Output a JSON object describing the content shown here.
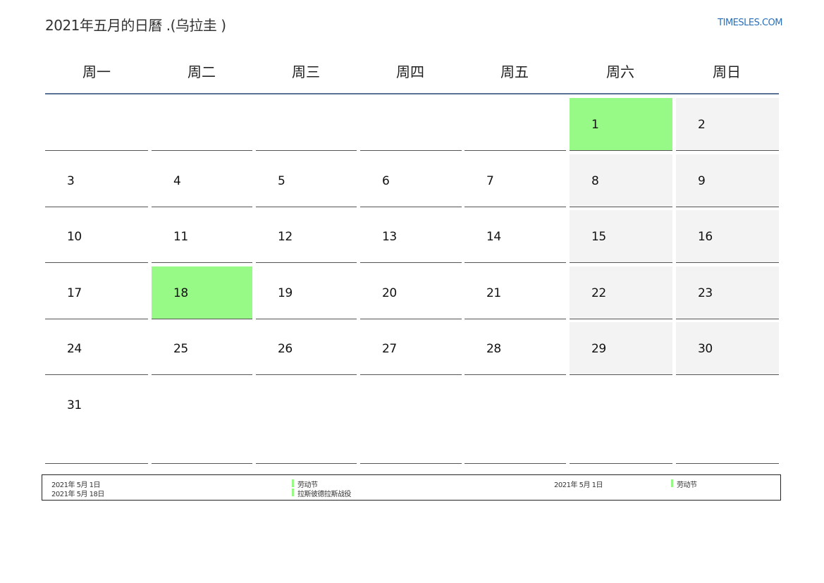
{
  "title": "2021年五月的日曆 .(乌拉圭 )",
  "brand": "TIMESLES.COM",
  "weekdays": [
    "周一",
    "周二",
    "周三",
    "周四",
    "周五",
    "周六",
    "周日"
  ],
  "days": {
    "d1": "1",
    "d2": "2",
    "d3": "3",
    "d4": "4",
    "d5": "5",
    "d6": "6",
    "d7": "7",
    "d8": "8",
    "d9": "9",
    "d10": "10",
    "d11": "11",
    "d12": "12",
    "d13": "13",
    "d14": "14",
    "d15": "15",
    "d16": "16",
    "d17": "17",
    "d18": "18",
    "d19": "19",
    "d20": "20",
    "d21": "21",
    "d22": "22",
    "d23": "23",
    "d24": "24",
    "d25": "25",
    "d26": "26",
    "d27": "27",
    "d28": "28",
    "d29": "29",
    "d30": "30",
    "d31": "31"
  },
  "holidays_list": [
    {
      "date": "2021年 5月 1日",
      "name": "劳动节"
    },
    {
      "date": "2021年 5月 18日",
      "name": "拉斯彼德拉斯战役"
    }
  ],
  "holidays_list_right": [
    {
      "date": "2021年 5月 1日",
      "name": "劳动节"
    }
  ],
  "colors": {
    "holiday": "#98fa86",
    "weekend": "#f3f3f3",
    "header_rule": "#5a7394",
    "brand": "#2a6fb8"
  }
}
